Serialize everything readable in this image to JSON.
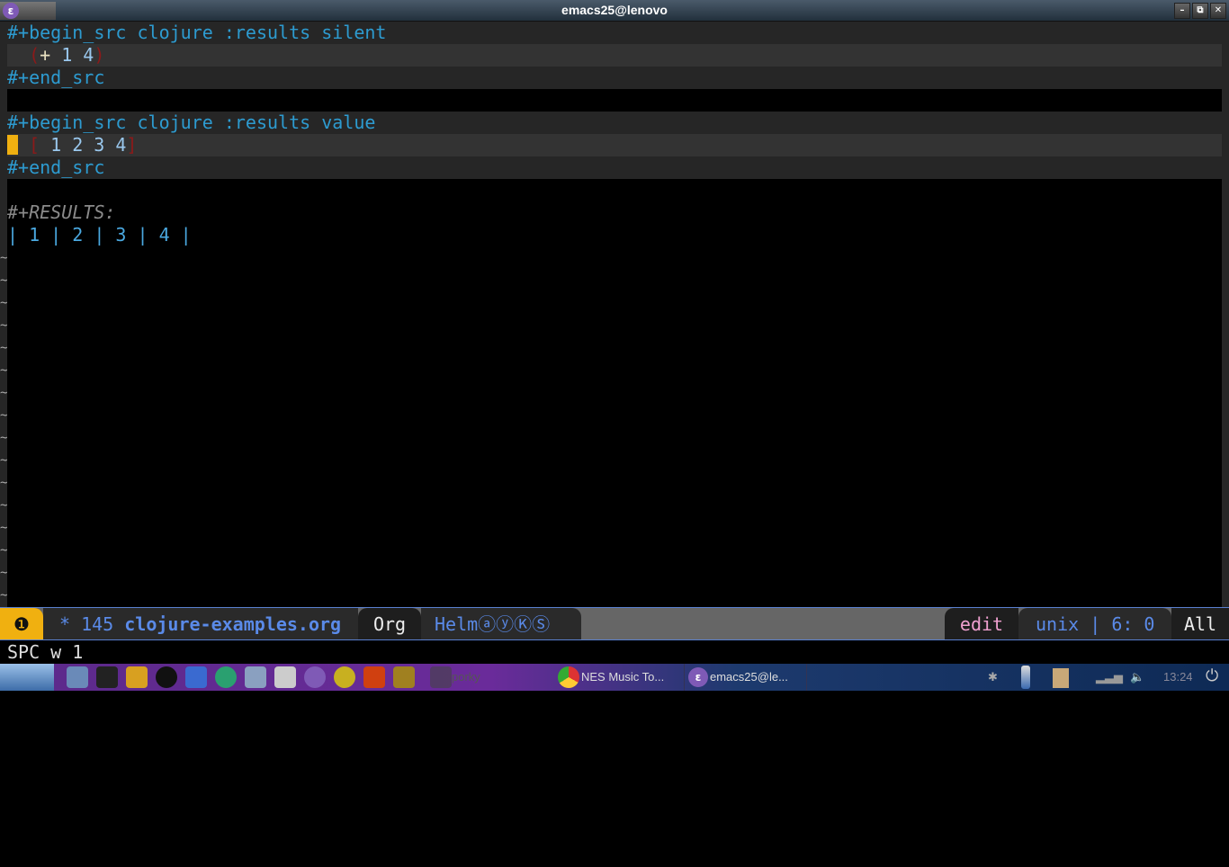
{
  "window": {
    "title": "emacs25@lenovo",
    "minimize": "–",
    "restore": "⧉",
    "close": "✕",
    "logo": "ε"
  },
  "buffer": {
    "block1": {
      "begin": "#+begin_src clojure :results silent",
      "open": "(",
      "plus": "+",
      "nums": " 1 4",
      "close": ")",
      "end": "#+end_src"
    },
    "block2": {
      "begin": "#+begin_src clojure :results value",
      "open": "[",
      "nums": " 1 2 3 4",
      "close": "]",
      "end": "#+end_src"
    },
    "results_label": "#+RESULTS:",
    "results_table": "| 1 | 2 | 3 | 4 |",
    "empty_line_marker": "~"
  },
  "modeline": {
    "window_number": "❶",
    "modified": "*",
    "size": "145",
    "filename": "clojure-examples.org",
    "major_mode": "Org",
    "minor_modes": "Helm",
    "minor_badges": [
      "ⓐ",
      "ⓨ",
      "Ⓚ",
      "Ⓢ"
    ],
    "state": "edit",
    "encoding": "unix",
    "separator": "|",
    "position": "6: 0",
    "scroll": "All"
  },
  "minibuffer": {
    "text": "SPC w 1"
  },
  "taskbar": {
    "launchers": [
      "menu",
      "files",
      "crt",
      "chrome",
      "obs",
      "kdenlive",
      "atom",
      "notes",
      "text-editor",
      "emacs",
      "mint",
      "audacity",
      "gimp"
    ],
    "tasks": [
      {
        "label": "porky"
      },
      {
        "label": "NES Music To..."
      },
      {
        "label": "emacs25@le..."
      }
    ],
    "clock": "13:24"
  }
}
